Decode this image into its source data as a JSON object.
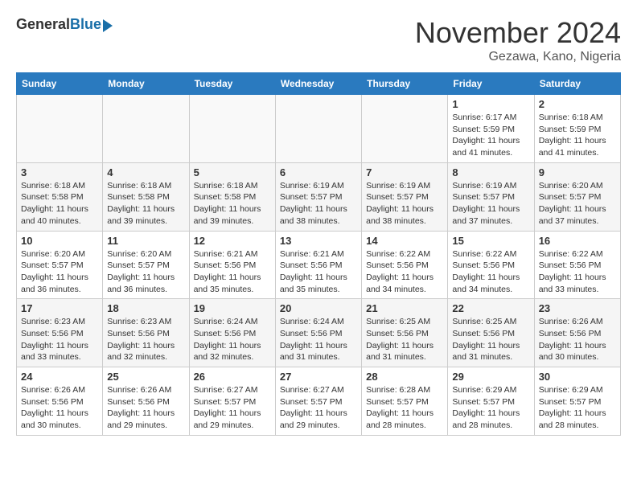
{
  "logo": {
    "general": "General",
    "blue": "Blue"
  },
  "title": "November 2024",
  "location": "Gezawa, Kano, Nigeria",
  "weekdays": [
    "Sunday",
    "Monday",
    "Tuesday",
    "Wednesday",
    "Thursday",
    "Friday",
    "Saturday"
  ],
  "weeks": [
    [
      {
        "day": "",
        "info": ""
      },
      {
        "day": "",
        "info": ""
      },
      {
        "day": "",
        "info": ""
      },
      {
        "day": "",
        "info": ""
      },
      {
        "day": "",
        "info": ""
      },
      {
        "day": "1",
        "info": "Sunrise: 6:17 AM\nSunset: 5:59 PM\nDaylight: 11 hours\nand 41 minutes."
      },
      {
        "day": "2",
        "info": "Sunrise: 6:18 AM\nSunset: 5:59 PM\nDaylight: 11 hours\nand 41 minutes."
      }
    ],
    [
      {
        "day": "3",
        "info": "Sunrise: 6:18 AM\nSunset: 5:58 PM\nDaylight: 11 hours\nand 40 minutes."
      },
      {
        "day": "4",
        "info": "Sunrise: 6:18 AM\nSunset: 5:58 PM\nDaylight: 11 hours\nand 39 minutes."
      },
      {
        "day": "5",
        "info": "Sunrise: 6:18 AM\nSunset: 5:58 PM\nDaylight: 11 hours\nand 39 minutes."
      },
      {
        "day": "6",
        "info": "Sunrise: 6:19 AM\nSunset: 5:57 PM\nDaylight: 11 hours\nand 38 minutes."
      },
      {
        "day": "7",
        "info": "Sunrise: 6:19 AM\nSunset: 5:57 PM\nDaylight: 11 hours\nand 38 minutes."
      },
      {
        "day": "8",
        "info": "Sunrise: 6:19 AM\nSunset: 5:57 PM\nDaylight: 11 hours\nand 37 minutes."
      },
      {
        "day": "9",
        "info": "Sunrise: 6:20 AM\nSunset: 5:57 PM\nDaylight: 11 hours\nand 37 minutes."
      }
    ],
    [
      {
        "day": "10",
        "info": "Sunrise: 6:20 AM\nSunset: 5:57 PM\nDaylight: 11 hours\nand 36 minutes."
      },
      {
        "day": "11",
        "info": "Sunrise: 6:20 AM\nSunset: 5:57 PM\nDaylight: 11 hours\nand 36 minutes."
      },
      {
        "day": "12",
        "info": "Sunrise: 6:21 AM\nSunset: 5:56 PM\nDaylight: 11 hours\nand 35 minutes."
      },
      {
        "day": "13",
        "info": "Sunrise: 6:21 AM\nSunset: 5:56 PM\nDaylight: 11 hours\nand 35 minutes."
      },
      {
        "day": "14",
        "info": "Sunrise: 6:22 AM\nSunset: 5:56 PM\nDaylight: 11 hours\nand 34 minutes."
      },
      {
        "day": "15",
        "info": "Sunrise: 6:22 AM\nSunset: 5:56 PM\nDaylight: 11 hours\nand 34 minutes."
      },
      {
        "day": "16",
        "info": "Sunrise: 6:22 AM\nSunset: 5:56 PM\nDaylight: 11 hours\nand 33 minutes."
      }
    ],
    [
      {
        "day": "17",
        "info": "Sunrise: 6:23 AM\nSunset: 5:56 PM\nDaylight: 11 hours\nand 33 minutes."
      },
      {
        "day": "18",
        "info": "Sunrise: 6:23 AM\nSunset: 5:56 PM\nDaylight: 11 hours\nand 32 minutes."
      },
      {
        "day": "19",
        "info": "Sunrise: 6:24 AM\nSunset: 5:56 PM\nDaylight: 11 hours\nand 32 minutes."
      },
      {
        "day": "20",
        "info": "Sunrise: 6:24 AM\nSunset: 5:56 PM\nDaylight: 11 hours\nand 31 minutes."
      },
      {
        "day": "21",
        "info": "Sunrise: 6:25 AM\nSunset: 5:56 PM\nDaylight: 11 hours\nand 31 minutes."
      },
      {
        "day": "22",
        "info": "Sunrise: 6:25 AM\nSunset: 5:56 PM\nDaylight: 11 hours\nand 31 minutes."
      },
      {
        "day": "23",
        "info": "Sunrise: 6:26 AM\nSunset: 5:56 PM\nDaylight: 11 hours\nand 30 minutes."
      }
    ],
    [
      {
        "day": "24",
        "info": "Sunrise: 6:26 AM\nSunset: 5:56 PM\nDaylight: 11 hours\nand 30 minutes."
      },
      {
        "day": "25",
        "info": "Sunrise: 6:26 AM\nSunset: 5:56 PM\nDaylight: 11 hours\nand 29 minutes."
      },
      {
        "day": "26",
        "info": "Sunrise: 6:27 AM\nSunset: 5:57 PM\nDaylight: 11 hours\nand 29 minutes."
      },
      {
        "day": "27",
        "info": "Sunrise: 6:27 AM\nSunset: 5:57 PM\nDaylight: 11 hours\nand 29 minutes."
      },
      {
        "day": "28",
        "info": "Sunrise: 6:28 AM\nSunset: 5:57 PM\nDaylight: 11 hours\nand 28 minutes."
      },
      {
        "day": "29",
        "info": "Sunrise: 6:29 AM\nSunset: 5:57 PM\nDaylight: 11 hours\nand 28 minutes."
      },
      {
        "day": "30",
        "info": "Sunrise: 6:29 AM\nSunset: 5:57 PM\nDaylight: 11 hours\nand 28 minutes."
      }
    ]
  ]
}
